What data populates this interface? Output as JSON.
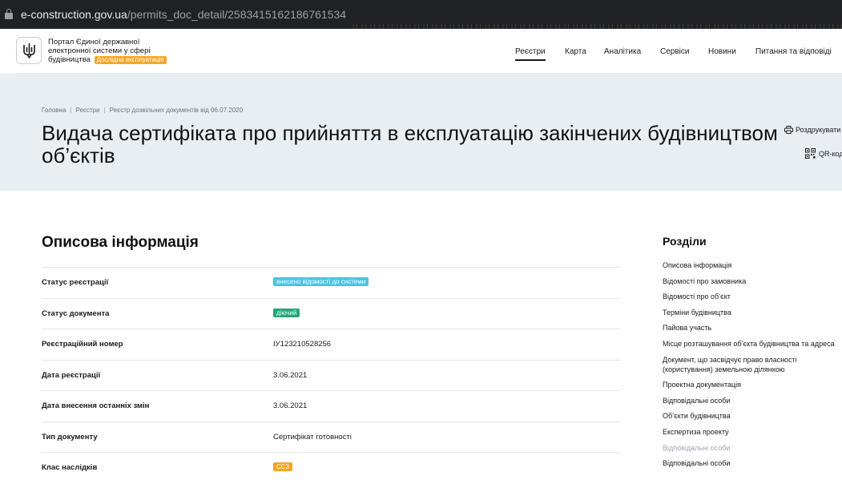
{
  "browser": {
    "url_host": "e-construction.gov.ua",
    "url_path": "/permits_doc_detail/2583415162186761534"
  },
  "header": {
    "portal_name": "Портал Єдиної державної електронної системи у сфері будівництва",
    "beta_badge": "Дослідна експлуатація",
    "nav": [
      {
        "label": "Реєстри",
        "active": true
      },
      {
        "label": "Карта"
      },
      {
        "label": "Аналітика"
      },
      {
        "label": "Сервіси"
      },
      {
        "label": "Новини"
      },
      {
        "label": "Питання та відповіді"
      }
    ]
  },
  "hero": {
    "breadcrumbs": [
      "Головна",
      "Реєстри",
      "Реєстр дозвільних документів від 06.07.2020"
    ],
    "title": "Видача сертифіката про прийняття в експлуатацію закінчених будівництвом об’єктів",
    "actions": {
      "print": "Роздрукувати",
      "qr": "QR-код"
    }
  },
  "main": {
    "section_title": "Описова інформація",
    "rows": [
      {
        "label": "Статус реєстрації",
        "value": "внесено відомості до системи",
        "badge_color": "#4fc1e0"
      },
      {
        "label": "Статус документа",
        "value": "діючий",
        "badge_color": "#22a67a"
      },
      {
        "label": "Реєстраційний номер",
        "value": "ІУ123210528256"
      },
      {
        "label": "Дата реєстрації",
        "value": "3.06.2021"
      },
      {
        "label": "Дата внесення останніх змін",
        "value": "3.06.2021"
      },
      {
        "label": "Тип документу",
        "value": "Сертифікат готовності"
      },
      {
        "label": "Клас наслідків",
        "value": "СС3",
        "badge_color": "#f5a623"
      }
    ]
  },
  "sidebar": {
    "title": "Розділи",
    "items": [
      {
        "label": "Описова інформація"
      },
      {
        "label": "Відомості про замовника"
      },
      {
        "label": "Відомості про об’єкт"
      },
      {
        "label": "Терміни будівництва"
      },
      {
        "label": "Пайова участь"
      },
      {
        "label": "Місце розташування об’єкта будівництва та адреса"
      },
      {
        "label": "Документ, що засвідчує право власності (користування) земельною ділянкою"
      },
      {
        "label": "Проектна документація"
      },
      {
        "label": "Відповідальні особи"
      },
      {
        "label": "Об’єкти будівництва"
      },
      {
        "label": "Експертиза проекту"
      },
      {
        "label": "Відповідальні особи",
        "muted": true
      },
      {
        "label": "Відповідальні особи"
      }
    ]
  }
}
